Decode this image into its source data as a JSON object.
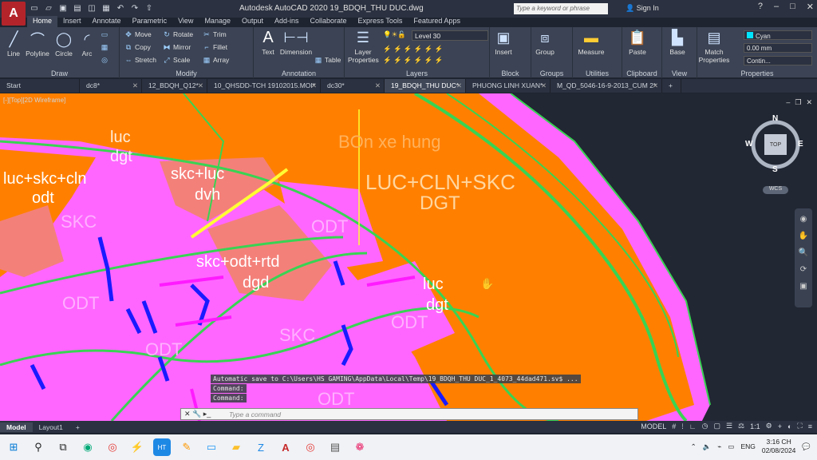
{
  "app": {
    "logo_letter": "A",
    "title": "Autodesk AutoCAD 2020    19_BDQH_THU DUC.dwg",
    "search_placeholder": "Type a keyword or phrase",
    "signin": "Sign In"
  },
  "ribbon_tabs": [
    "Home",
    "Insert",
    "Annotate",
    "Parametric",
    "View",
    "Manage",
    "Output",
    "Add-ins",
    "Collaborate",
    "Express Tools",
    "Featured Apps"
  ],
  "ribbon": {
    "draw": {
      "label": "Draw",
      "line": "Line",
      "polyline": "Polyline",
      "circle": "Circle",
      "arc": "Arc"
    },
    "modify": {
      "label": "Modify",
      "move": "Move",
      "rotate": "Rotate",
      "trim": "Trim",
      "copy": "Copy",
      "mirror": "Mirror",
      "fillet": "Fillet",
      "stretch": "Stretch",
      "scale": "Scale",
      "array": "Array"
    },
    "annotation": {
      "label": "Annotation",
      "text": "Text",
      "dimension": "Dimension",
      "table": "Table"
    },
    "layers": {
      "label": "Layers",
      "layer_properties": "Layer Properties",
      "current_layer": "Level 30"
    },
    "block": {
      "label": "Block",
      "insert": "Insert"
    },
    "groups": {
      "label": "Groups",
      "group": "Group"
    },
    "utilities": {
      "label": "Utilities",
      "measure": "Measure"
    },
    "clipboard": {
      "label": "Clipboard",
      "paste": "Paste"
    },
    "view": {
      "label": "View",
      "base": "Base"
    },
    "properties": {
      "label": "Properties",
      "match": "Match Properties",
      "color": "Cyan",
      "lineweight": "0.00 mm",
      "linetype": "Contin..."
    }
  },
  "doc_tabs": [
    "Start",
    "dc8*",
    "12_BDQH_Q12*",
    "10_QHSDD-TCH 19102015.MOI*",
    "dc30*",
    "19_BDQH_THU DUC*",
    "PHUONG LINH XUAN*",
    "M_QD_5046-16-9-2013_CUM 2*"
  ],
  "viewport": {
    "label": "[-][Top][2D Wireframe]",
    "viewcube": {
      "top": "TOP",
      "n": "N",
      "s": "S",
      "e": "E",
      "w": "W",
      "wcs": "WCS"
    },
    "map_labels": [
      "luc",
      "dgt",
      "BOn xe hung",
      "LUC+CLN+SKC",
      "DGT",
      "skc+luc",
      "dvh",
      "luc+skc+cln",
      "odt",
      "SKC",
      "ODT",
      "skc+odt+rtd",
      "dgd",
      "ODT",
      "ODT",
      "luc",
      "dgt",
      "ODT",
      "SKC",
      "ODT"
    ]
  },
  "command": {
    "autosave": "Automatic save to C:\\Users\\HS GAMING\\AppData\\Local\\Temp\\19_BDQH_THU DUC_1_4073_44dad471.sv$ ...",
    "line1": "Command:",
    "line2": "Command:",
    "placeholder": "Type a command"
  },
  "layout_tabs": [
    "Model",
    "Layout1"
  ],
  "status": {
    "mode": "MODEL",
    "scale": "1:1"
  },
  "taskbar": {
    "lang": "ENG",
    "time": "3:16 CH",
    "date": "02/08/2024"
  },
  "colors": {
    "orange": "#ff8000",
    "pink": "#ff66ff",
    "salmon": "#f4807a",
    "green": "#39d353",
    "blue": "#1a1aff",
    "yellow": "#ffff33",
    "bg": "#212733"
  }
}
